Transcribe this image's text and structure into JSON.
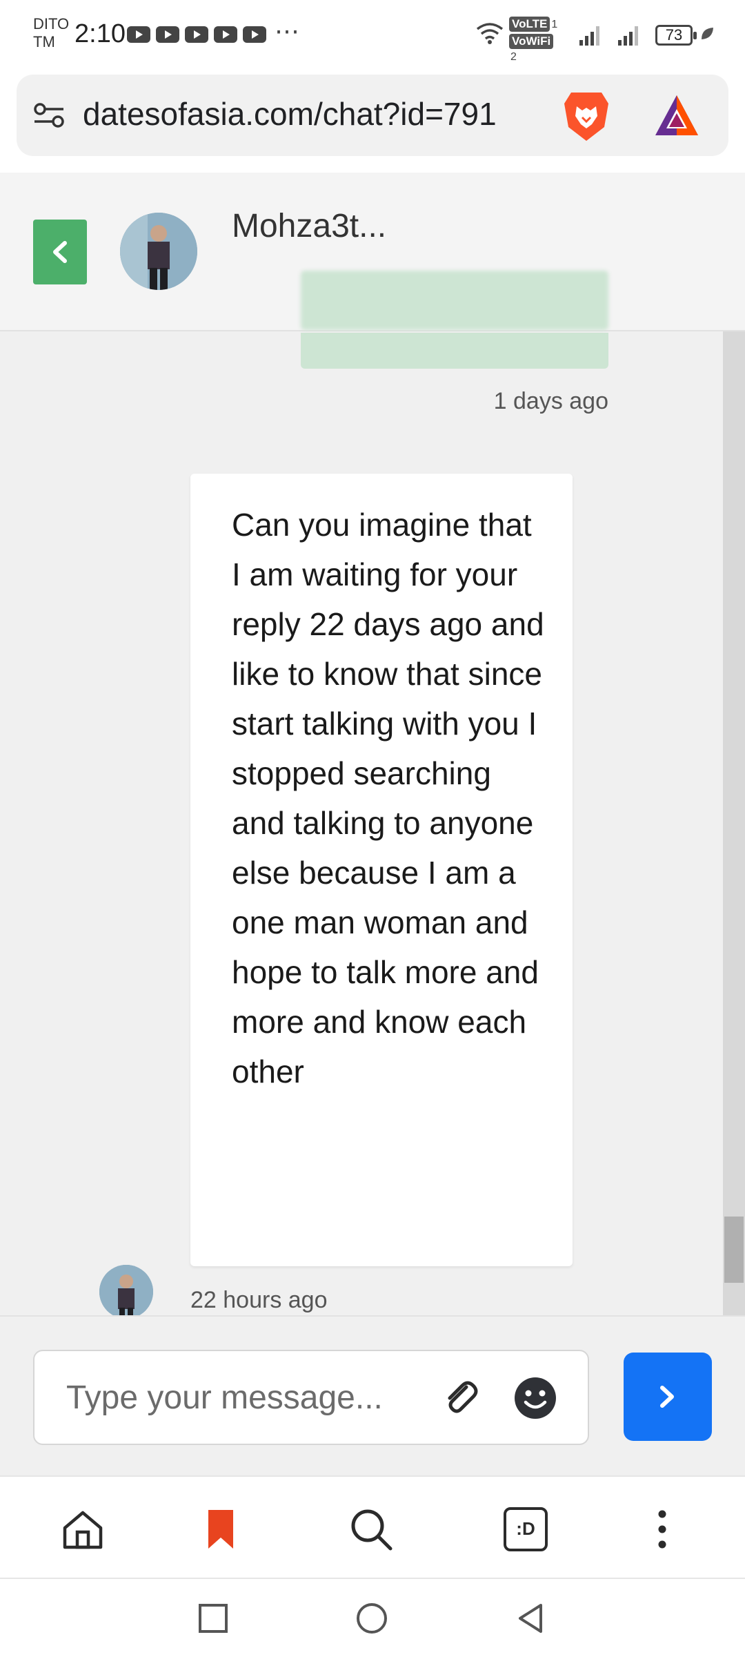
{
  "status_bar": {
    "carrier_line1": "DITO",
    "carrier_line2": "TM",
    "time": "2:10",
    "more": "⋯",
    "volte": "VoLTE",
    "volte_sim": "1",
    "vowifi": "VoWiFi",
    "vowifi_sim": "2",
    "battery": "73"
  },
  "browser": {
    "url": "datesofasia.com/chat?id=791",
    "icons": [
      "tune-icon",
      "brave-lion-icon",
      "bat-rewards-icon"
    ]
  },
  "chat": {
    "contact_name": "Mohza3t...",
    "messages": [
      {
        "direction": "sent",
        "text": "",
        "time": "1 days ago"
      },
      {
        "direction": "received",
        "text": "Can you imagine that I am waiting for your reply 22 days ago and like to know that since start talking with you I stopped searching and talking to anyone else because I am a one man woman and hope to talk more and more and know each other",
        "time": "22 hours ago"
      }
    ]
  },
  "composer": {
    "placeholder": "Type your message..."
  },
  "bottom_nav": {
    "items": [
      "home-icon",
      "bookmark-icon",
      "search-icon",
      "tabs-icon",
      "menu-icon"
    ],
    "tabs_label": ":D"
  },
  "colors": {
    "accent_green": "#4caf6a",
    "send_blue": "#1473f5",
    "sent_bubble": "#cde5d3",
    "bookmark_orange": "#e8441f"
  }
}
